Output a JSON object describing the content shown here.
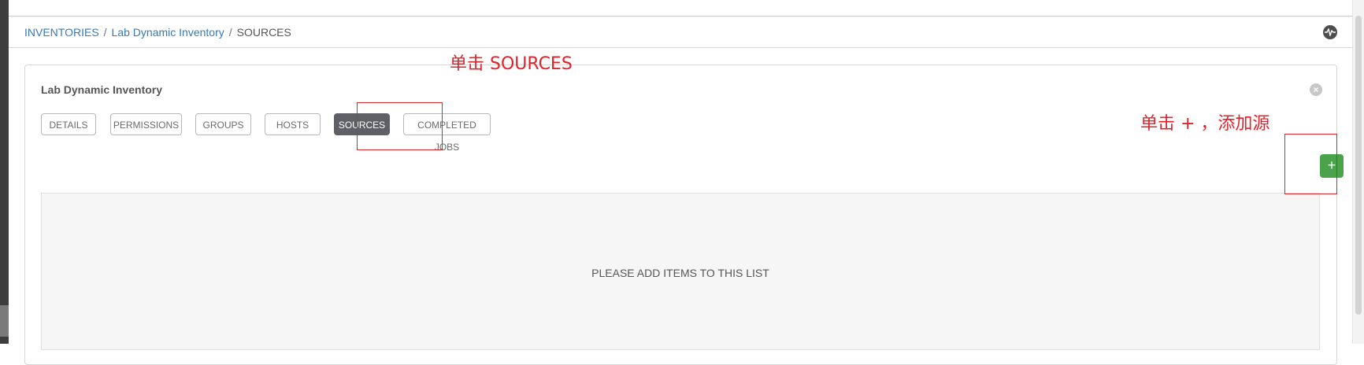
{
  "breadcrumb": {
    "items": [
      {
        "label": "INVENTORIES"
      },
      {
        "label": "Lab Dynamic Inventory"
      },
      {
        "label": "SOURCES"
      }
    ],
    "separator": "/"
  },
  "panel": {
    "title": "Lab Dynamic Inventory",
    "tabs": [
      {
        "label": "DETAILS"
      },
      {
        "label": "PERMISSIONS"
      },
      {
        "label": "GROUPS"
      },
      {
        "label": "HOSTS"
      },
      {
        "label": "SOURCES",
        "active": true
      },
      {
        "label": "COMPLETED JOBS"
      }
    ],
    "add_button_label": "+",
    "empty_message": "PLEASE ADD ITEMS TO THIS LIST"
  },
  "annotations": {
    "sources_hint": "单击 SOURCES",
    "add_hint": "单击 + ，添加源"
  },
  "colors": {
    "link": "#337ab7",
    "active_tab": "#5f6066",
    "add_button": "#4aa24a",
    "annotation": "#e0232a"
  },
  "icons": [
    "activity-stream-icon",
    "close-icon"
  ]
}
